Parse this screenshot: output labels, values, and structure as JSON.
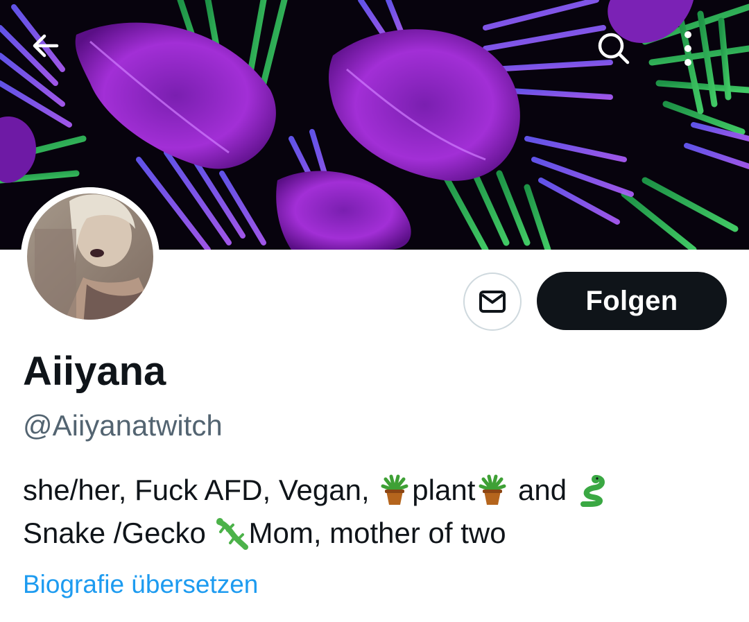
{
  "header": {
    "back_icon": "arrow-left-icon",
    "search_icon": "search-icon",
    "more_icon": "more-vertical-icon"
  },
  "profile": {
    "display_name": "Aiiyana",
    "handle": "@Aiiyanatwitch",
    "bio": {
      "line1": {
        "part1": "she/her, Fuck AFD, Vegan, ",
        "emoji1": "potted-plant-icon",
        "part2": "plant",
        "emoji2": "potted-plant-icon",
        "part3": " and ",
        "emoji3": "snake-icon"
      },
      "line2": {
        "part1": "Snake /Gecko ",
        "emoji1": "lizard-icon",
        "part2": "Mom, mother of two"
      }
    },
    "translate_bio_label": "Biografie übersetzen"
  },
  "actions": {
    "message_icon": "envelope-icon",
    "follow_label": "Folgen"
  },
  "colors": {
    "text_primary": "#0f1419",
    "text_secondary": "#536471",
    "link": "#1d9bf0",
    "follow_bg": "#0f1419",
    "border": "#cfd9de"
  }
}
